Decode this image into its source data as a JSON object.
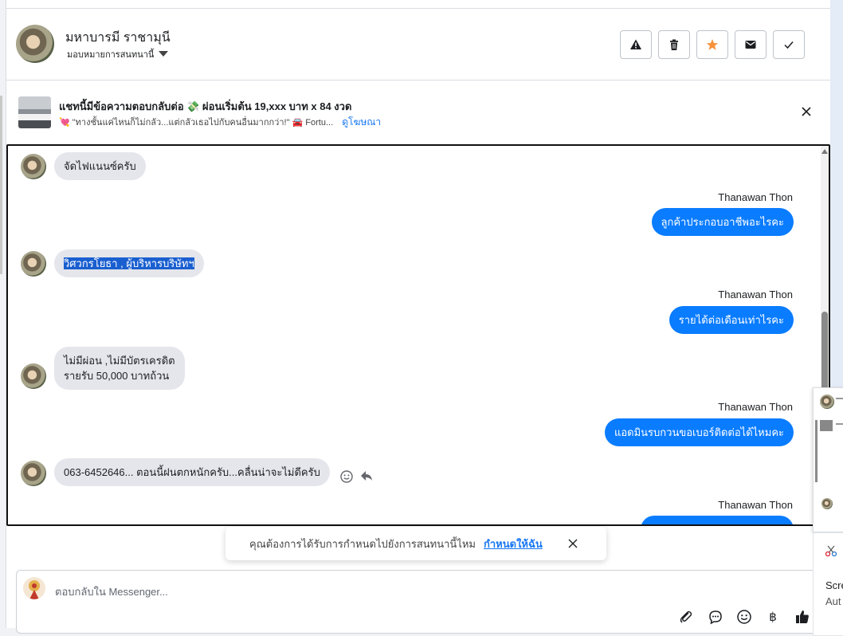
{
  "header": {
    "name": "มหาบารมี ราชามุนี",
    "assign_label": "มอบหมายการสนทนานี้",
    "buttons": [
      "report",
      "delete",
      "star",
      "mark-unread",
      "done"
    ]
  },
  "ad": {
    "title": "แชทนี้มีข้อความตอบกลับต่อ 💸 ผ่อนเริ่มต้น 19,xxx บาท x 84 งวด",
    "subtitle": "💘 \"ทางชั้นแค่ไหนก็ไม่กลัว...แต่กลัวเธอไปกับคนอื่นมากกว่า!\" 🚘 Fortu...",
    "link": "ดูโฆษณา"
  },
  "messages": [
    {
      "dir": "in",
      "text": "จัดไฟแนนซ์ครับ"
    },
    {
      "dir": "out",
      "sender": "Thanawan Thon",
      "text": "ลูกค้าประกอบอาชีพอะไรคะ"
    },
    {
      "dir": "in",
      "text": "วิศวกรโยธา , ผู้บริหารบริษัทฯ"
    },
    {
      "dir": "out",
      "sender": "Thanawan Thon",
      "text": "รายได้ต่อเดือนเท่าไรคะ"
    },
    {
      "dir": "in",
      "text": "ไม่มีผ่อน ,ไม่มีบัตรเครดิต\nรายรับ 50,000 บาทถ้วน"
    },
    {
      "dir": "out",
      "sender": "Thanawan Thon",
      "text": "แอดมินรบกวนขอเบอร์ติดต่อได้ไหมคะ"
    },
    {
      "dir": "in",
      "text": "063-6452646... ตอนนี้ฝนตกหนักครับ...คลื่นน่าจะไม่ดีครับ"
    },
    {
      "dir": "out",
      "sender": "Thanawan Thon",
      "text": ""
    }
  ],
  "toast": {
    "text": "คุณต้องการได้รับการกำหนดไปยังการสนทนานี้ไหม",
    "link": "กำหนดให้ฉัน"
  },
  "composer": {
    "placeholder": "ตอบกลับใน Messenger...",
    "tools": [
      "paperclip-icon",
      "chat-bubble-icon",
      "emoji-icon",
      "baht-icon",
      "thumbs-up-icon"
    ]
  },
  "side_popup": {
    "line1": "Scre",
    "line2": "Aut"
  },
  "colors": {
    "outgoing_bubble": "#0a7cff",
    "incoming_bubble": "#e4e6eb",
    "link": "#1877f2",
    "star": "#f7923a"
  }
}
